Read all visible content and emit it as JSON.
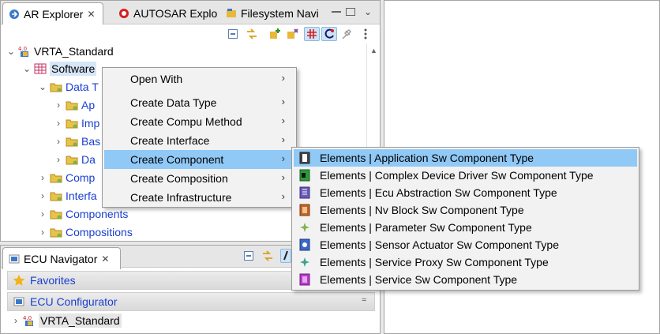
{
  "explorer": {
    "tabs": [
      {
        "label": "AR Explorer",
        "icon": "ar-explorer-icon",
        "close": "✕"
      },
      {
        "label": "AUTOSAR Explo",
        "icon": "autosar-icon"
      },
      {
        "label": "Filesystem Navi",
        "icon": "filesystem-icon"
      }
    ],
    "view_menu": "⌄",
    "tree": [
      {
        "label": "VRTA_Standard",
        "icon": "project-icon",
        "expanded": true
      },
      {
        "label": "Software",
        "icon": "package-icon",
        "expanded": true
      },
      {
        "label": "Data T",
        "icon": "folder-icon",
        "expanded": true
      },
      {
        "label": "Ap",
        "icon": "folder-icon"
      },
      {
        "label": "Imp",
        "icon": "folder-icon"
      },
      {
        "label": "Bas",
        "icon": "folder-icon"
      },
      {
        "label": "Da",
        "icon": "folder-icon"
      },
      {
        "label": "Comp",
        "icon": "folder-icon"
      },
      {
        "label": "Interfa",
        "icon": "folder-icon"
      },
      {
        "label": "Components",
        "icon": "folder-icon"
      },
      {
        "label": "Compositions",
        "icon": "folder-icon"
      }
    ]
  },
  "navigator": {
    "tab_label": "ECU Navigator",
    "close": "✕",
    "sections": [
      {
        "label": "Favorites",
        "icon": "star-icon"
      },
      {
        "label": "ECU Configurator",
        "icon": "ecu-configurator-icon",
        "chevron": "≈"
      }
    ],
    "tree": [
      {
        "label": "VRTA_Standard",
        "icon": "project-icon"
      }
    ]
  },
  "context_menu": {
    "items": [
      {
        "label": "Open With",
        "submenu": true
      },
      {
        "label": "Create Data Type",
        "submenu": true
      },
      {
        "label": "Create Compu Method",
        "submenu": true
      },
      {
        "label": "Create Interface",
        "submenu": true
      },
      {
        "label": "Create Component",
        "submenu": true,
        "highlighted": true
      },
      {
        "label": "Create Composition",
        "submenu": true
      },
      {
        "label": "Create Infrastructure",
        "submenu": true
      }
    ],
    "submenu_arrow": "›"
  },
  "submenu": {
    "items": [
      {
        "label": "Elements | Application Sw Component Type",
        "icon": "application-swc-icon",
        "highlighted": true
      },
      {
        "label": "Elements | Complex Device Driver Sw Component Type",
        "icon": "cdd-swc-icon"
      },
      {
        "label": "Elements | Ecu Abstraction Sw Component Type",
        "icon": "ecu-abstraction-swc-icon"
      },
      {
        "label": "Elements | Nv Block Sw Component Type",
        "icon": "nvblock-swc-icon"
      },
      {
        "label": "Elements | Parameter Sw Component Type",
        "icon": "parameter-swc-icon"
      },
      {
        "label": "Elements | Sensor Actuator Sw Component Type",
        "icon": "sensor-actuator-swc-icon"
      },
      {
        "label": "Elements | Service Proxy Sw Component Type",
        "icon": "service-proxy-swc-icon"
      },
      {
        "label": "Elements | Service Sw Component Type",
        "icon": "service-swc-icon"
      }
    ]
  },
  "colors": {
    "link": "#1a3fcf",
    "menu_highlight": "#90c8f6",
    "selection": "#d6e6f8"
  }
}
